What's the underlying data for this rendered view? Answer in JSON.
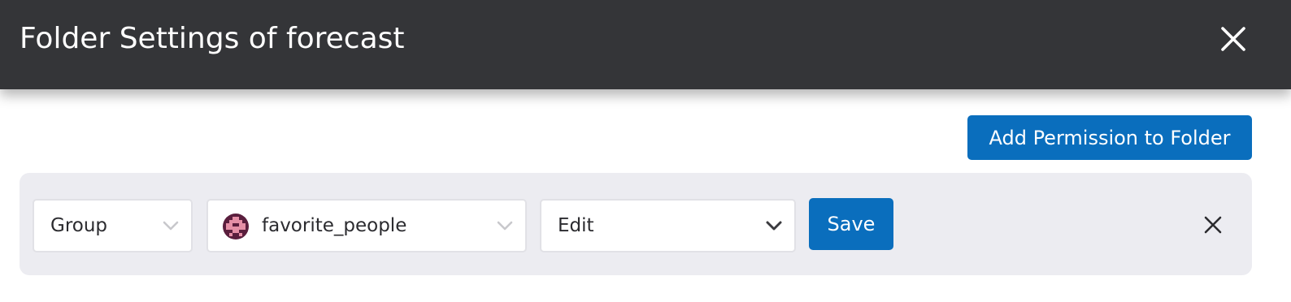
{
  "header": {
    "title": "Folder Settings of forecast",
    "close_icon": "close-icon"
  },
  "actions": {
    "add_permission_label": "Add Permission to Folder"
  },
  "permission_row": {
    "type_select": {
      "selected": "Group",
      "icon": "chevron-down-icon"
    },
    "group_select": {
      "selected": "favorite_people",
      "avatar_icon": "group-avatar-icon",
      "icon": "chevron-down-icon"
    },
    "permission_select": {
      "selected": "Edit",
      "icon": "chevron-down-icon"
    },
    "save_label": "Save",
    "remove_icon": "close-icon"
  },
  "colors": {
    "header_bg": "#343538",
    "primary": "#0a6ebd",
    "row_bg": "#ececf1",
    "avatar_bg": "#5a1e3d",
    "avatar_fg": "#e58fa6"
  }
}
